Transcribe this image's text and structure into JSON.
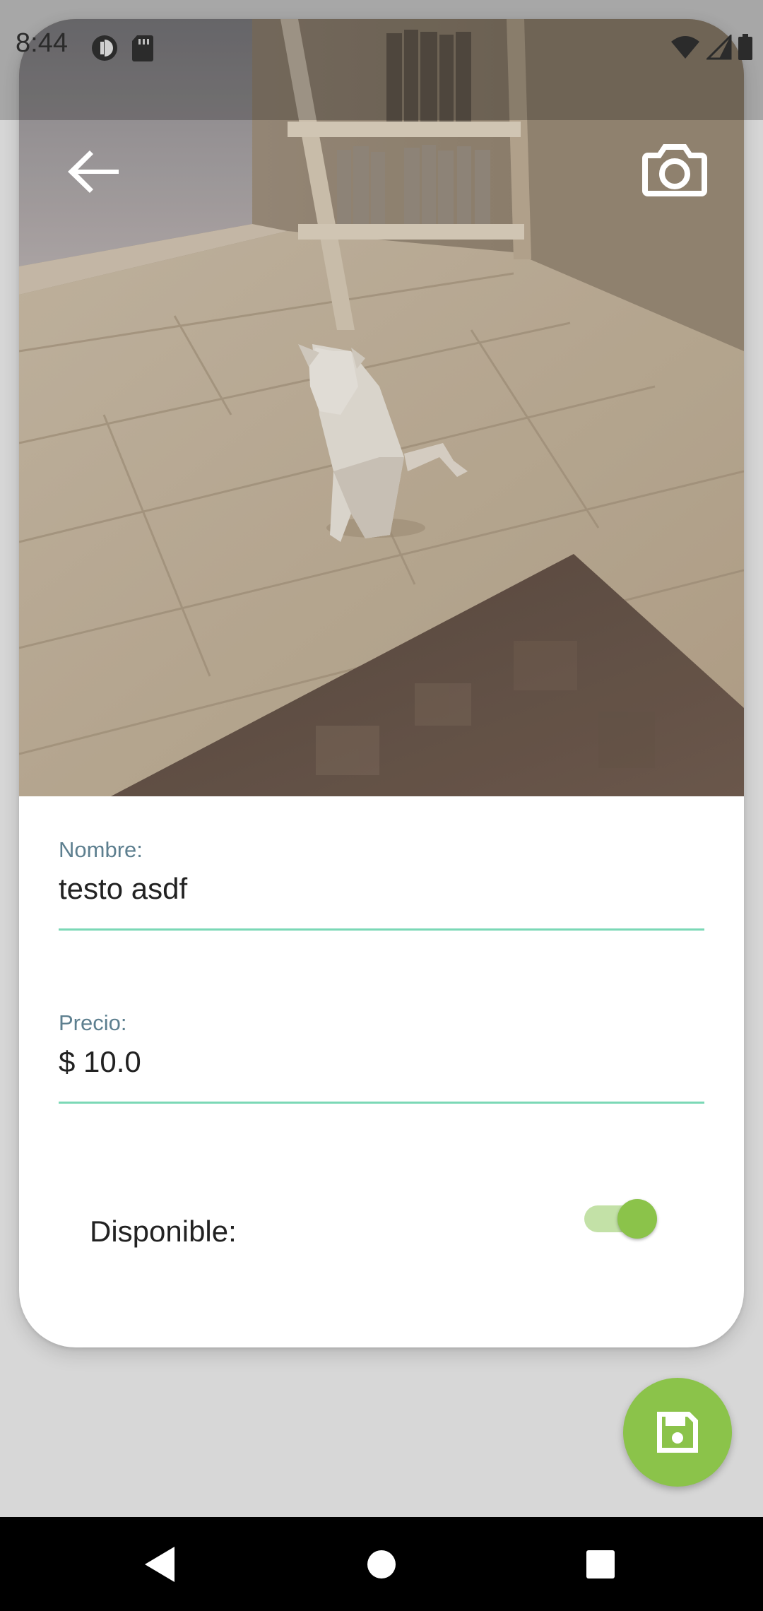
{
  "status_bar": {
    "time": "8:44",
    "left_icons": [
      "data-saver-icon",
      "sd-card-icon"
    ],
    "right_icons": [
      "wifi-icon",
      "cell-signal-icon",
      "battery-icon"
    ]
  },
  "app_bar": {
    "back_icon": "arrow-back-icon",
    "camera_icon": "camera-icon"
  },
  "form": {
    "name": {
      "label": "Nombre:",
      "value": "testo asdf"
    },
    "price": {
      "label": "Precio:",
      "value": "$ 10.0"
    },
    "available": {
      "label": "Disponible:",
      "checked": true
    }
  },
  "fab": {
    "icon": "save-icon"
  },
  "nav_bar": {
    "buttons": [
      "nav-back-icon",
      "nav-home-icon",
      "nav-recents-icon"
    ]
  },
  "colors": {
    "accent_green": "#8bc34a",
    "underline_teal": "#7bd8b6",
    "label_blue_gray": "#5d7f8f",
    "background": "#d7d7d7"
  }
}
